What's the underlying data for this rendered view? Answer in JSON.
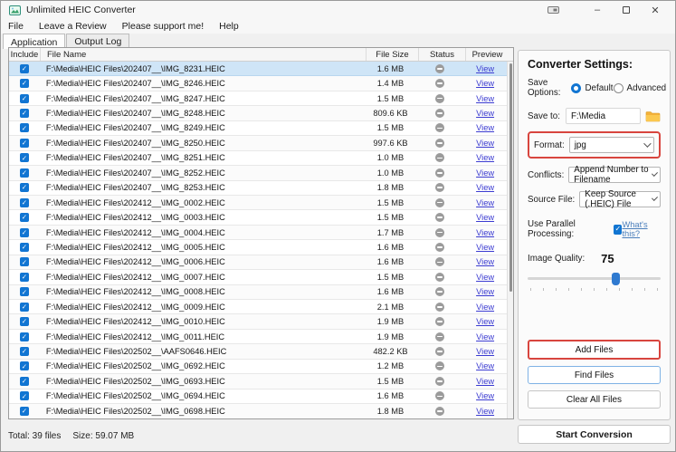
{
  "window": {
    "title": "Unlimited HEIC Converter",
    "controls": {
      "minimize": "–",
      "close": "✕"
    }
  },
  "menu": {
    "items": [
      {
        "label": "File"
      },
      {
        "label": "Leave a Review"
      },
      {
        "label": "Please support me!"
      },
      {
        "label": "Help"
      }
    ]
  },
  "tabs": [
    {
      "label": "Application",
      "active": true
    },
    {
      "label": "Output Log",
      "active": false
    }
  ],
  "table": {
    "columns": [
      "Include",
      "File Name",
      "File Size",
      "Status",
      "Preview"
    ],
    "preview_link_label": "View",
    "rows": [
      {
        "name": "F:\\Media\\HEIC Files\\202407__\\IMG_8231.HEIC",
        "size": "1.6 MB",
        "checked": true,
        "selected": true
      },
      {
        "name": "F:\\Media\\HEIC Files\\202407__\\IMG_8246.HEIC",
        "size": "1.4 MB",
        "checked": true,
        "selected": false
      },
      {
        "name": "F:\\Media\\HEIC Files\\202407__\\IMG_8247.HEIC",
        "size": "1.5 MB",
        "checked": true,
        "selected": false
      },
      {
        "name": "F:\\Media\\HEIC Files\\202407__\\IMG_8248.HEIC",
        "size": "809.6 KB",
        "checked": true,
        "selected": false
      },
      {
        "name": "F:\\Media\\HEIC Files\\202407__\\IMG_8249.HEIC",
        "size": "1.5 MB",
        "checked": true,
        "selected": false
      },
      {
        "name": "F:\\Media\\HEIC Files\\202407__\\IMG_8250.HEIC",
        "size": "997.6 KB",
        "checked": true,
        "selected": false
      },
      {
        "name": "F:\\Media\\HEIC Files\\202407__\\IMG_8251.HEIC",
        "size": "1.0 MB",
        "checked": true,
        "selected": false
      },
      {
        "name": "F:\\Media\\HEIC Files\\202407__\\IMG_8252.HEIC",
        "size": "1.0 MB",
        "checked": true,
        "selected": false
      },
      {
        "name": "F:\\Media\\HEIC Files\\202407__\\IMG_8253.HEIC",
        "size": "1.8 MB",
        "checked": true,
        "selected": false
      },
      {
        "name": "F:\\Media\\HEIC Files\\202412__\\IMG_0002.HEIC",
        "size": "1.5 MB",
        "checked": true,
        "selected": false
      },
      {
        "name": "F:\\Media\\HEIC Files\\202412__\\IMG_0003.HEIC",
        "size": "1.5 MB",
        "checked": true,
        "selected": false
      },
      {
        "name": "F:\\Media\\HEIC Files\\202412__\\IMG_0004.HEIC",
        "size": "1.7 MB",
        "checked": true,
        "selected": false
      },
      {
        "name": "F:\\Media\\HEIC Files\\202412__\\IMG_0005.HEIC",
        "size": "1.6 MB",
        "checked": true,
        "selected": false
      },
      {
        "name": "F:\\Media\\HEIC Files\\202412__\\IMG_0006.HEIC",
        "size": "1.6 MB",
        "checked": true,
        "selected": false
      },
      {
        "name": "F:\\Media\\HEIC Files\\202412__\\IMG_0007.HEIC",
        "size": "1.5 MB",
        "checked": true,
        "selected": false
      },
      {
        "name": "F:\\Media\\HEIC Files\\202412__\\IMG_0008.HEIC",
        "size": "1.6 MB",
        "checked": true,
        "selected": false
      },
      {
        "name": "F:\\Media\\HEIC Files\\202412__\\IMG_0009.HEIC",
        "size": "2.1 MB",
        "checked": true,
        "selected": false
      },
      {
        "name": "F:\\Media\\HEIC Files\\202412__\\IMG_0010.HEIC",
        "size": "1.9 MB",
        "checked": true,
        "selected": false
      },
      {
        "name": "F:\\Media\\HEIC Files\\202412__\\IMG_0011.HEIC",
        "size": "1.9 MB",
        "checked": true,
        "selected": false
      },
      {
        "name": "F:\\Media\\HEIC Files\\202502__\\AAFS0646.HEIC",
        "size": "482.2 KB",
        "checked": true,
        "selected": false
      },
      {
        "name": "F:\\Media\\HEIC Files\\202502__\\IMG_0692.HEIC",
        "size": "1.2 MB",
        "checked": true,
        "selected": false
      },
      {
        "name": "F:\\Media\\HEIC Files\\202502__\\IMG_0693.HEIC",
        "size": "1.5 MB",
        "checked": true,
        "selected": false
      },
      {
        "name": "F:\\Media\\HEIC Files\\202502__\\IMG_0694.HEIC",
        "size": "1.6 MB",
        "checked": true,
        "selected": false
      },
      {
        "name": "F:\\Media\\HEIC Files\\202502__\\IMG_0698.HEIC",
        "size": "1.8 MB",
        "checked": true,
        "selected": false
      }
    ]
  },
  "settings": {
    "heading": "Converter Settings:",
    "save_options": {
      "label": "Save Options:",
      "options": [
        "Default",
        "Advanced"
      ],
      "selected": "Default"
    },
    "save_to": {
      "label": "Save to:",
      "value": "F:\\Media"
    },
    "format": {
      "label": "Format:",
      "value": "jpg",
      "highlighted": true
    },
    "conflicts": {
      "label": "Conflicts:",
      "value": "Append Number to Filename"
    },
    "source_file": {
      "label": "Source File:",
      "value": "Keep Source (.HEIC) File"
    },
    "parallel": {
      "label": "Use Parallel Processing:",
      "checked": true,
      "help_link": "What's this?"
    },
    "image_quality": {
      "label": "Image Quality:",
      "value": "75"
    },
    "buttons": {
      "add": "Add Files",
      "find": "Find Files",
      "clear": "Clear All Files",
      "start": "Start Conversion"
    }
  },
  "status_bar": {
    "total": "Total: 39 files",
    "size": "Size: 59.07 MB"
  },
  "colors": {
    "accent": "#1175d2",
    "link": "#3b3bd1",
    "whats": "#4a7ebb",
    "red": "#d8453e",
    "selrow": "#cfe5f7",
    "slider": "#2f7ad0"
  }
}
